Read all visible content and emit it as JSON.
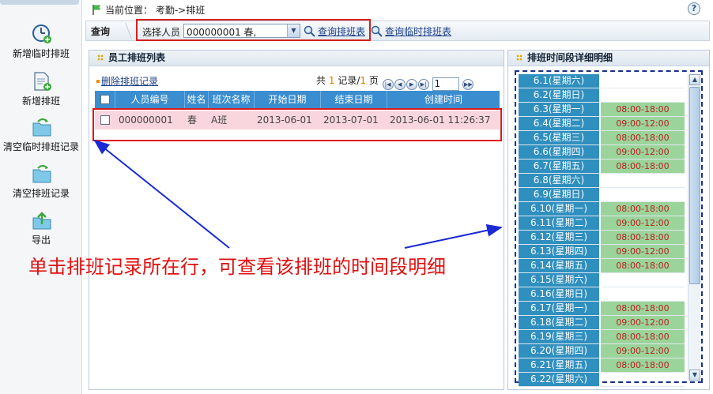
{
  "header": {
    "location": "当前位置： 考勤->排班",
    "help": "?"
  },
  "sidebar": {
    "items": [
      {
        "label": "新增临时排班",
        "icon": "clock-add-icon"
      },
      {
        "label": "新增排班",
        "icon": "document-add-icon"
      },
      {
        "label": "清空临时排班记录",
        "icon": "folder-arrow-icon"
      },
      {
        "label": "清空排班记录",
        "icon": "folder-arrow-icon"
      },
      {
        "label": "导出",
        "icon": "export-icon"
      }
    ]
  },
  "toolbar": {
    "query_label": "查询",
    "select_label": "选择人员",
    "select_value": "000000001 春,",
    "query_schedule": "查询排班表",
    "query_temp_schedule": "查询临时排班表"
  },
  "left_panel": {
    "title": "员工排班列表",
    "delete_link": "删除排班记录",
    "pager": {
      "prefix": "共",
      "records": "1",
      "records_label": "记录/",
      "pages": "1",
      "pages_label": "页",
      "page_input": "1"
    },
    "columns": [
      "人员编号",
      "姓名",
      "班次名称",
      "开始日期",
      "结束日期",
      "创建时间"
    ],
    "rows": [
      {
        "id": "000000001",
        "name": "春",
        "shift": "A班",
        "start": "2013-06-01",
        "end": "2013-07-01",
        "created": "2013-06-01 11:26:37"
      }
    ]
  },
  "right_panel": {
    "title": "排班时间段详细明细",
    "days": [
      {
        "day": "6.1(星期六)",
        "time": ""
      },
      {
        "day": "6.2(星期日)",
        "time": ""
      },
      {
        "day": "6.3(星期一)",
        "time": "08:00-18:00"
      },
      {
        "day": "6.4(星期二)",
        "time": "09:00-12:00"
      },
      {
        "day": "6.5(星期三)",
        "time": "08:00-18:00"
      },
      {
        "day": "6.6(星期四)",
        "time": "09:00-12:00"
      },
      {
        "day": "6.7(星期五)",
        "time": "08:00-18:00"
      },
      {
        "day": "6.8(星期六)",
        "time": ""
      },
      {
        "day": "6.9(星期日)",
        "time": ""
      },
      {
        "day": "6.10(星期一)",
        "time": "08:00-18:00"
      },
      {
        "day": "6.11(星期二)",
        "time": "09:00-12:00"
      },
      {
        "day": "6.12(星期三)",
        "time": "08:00-18:00"
      },
      {
        "day": "6.13(星期四)",
        "time": "09:00-12:00"
      },
      {
        "day": "6.14(星期五)",
        "time": "08:00-18:00"
      },
      {
        "day": "6.15(星期六)",
        "time": ""
      },
      {
        "day": "6.16(星期日)",
        "time": ""
      },
      {
        "day": "6.17(星期一)",
        "time": "08:00-18:00"
      },
      {
        "day": "6.18(星期二)",
        "time": "09:00-12:00"
      },
      {
        "day": "6.19(星期三)",
        "time": "08:00-18:00"
      },
      {
        "day": "6.20(星期四)",
        "time": "09:00-12:00"
      },
      {
        "day": "6.21(星期五)",
        "time": "08:00-18:00"
      },
      {
        "day": "6.22(星期六)",
        "time": ""
      }
    ]
  },
  "annotation": "单击排班记录所在行，可查看该排班的时间段明细",
  "colors": {
    "highlight_red": "#e01818",
    "header_blue": "#3a8ed0",
    "row_pink": "#f9d6de",
    "time_green": "#9bd49a",
    "day_blue": "#2f8fbf",
    "arrow_blue": "#1a2ad6"
  }
}
